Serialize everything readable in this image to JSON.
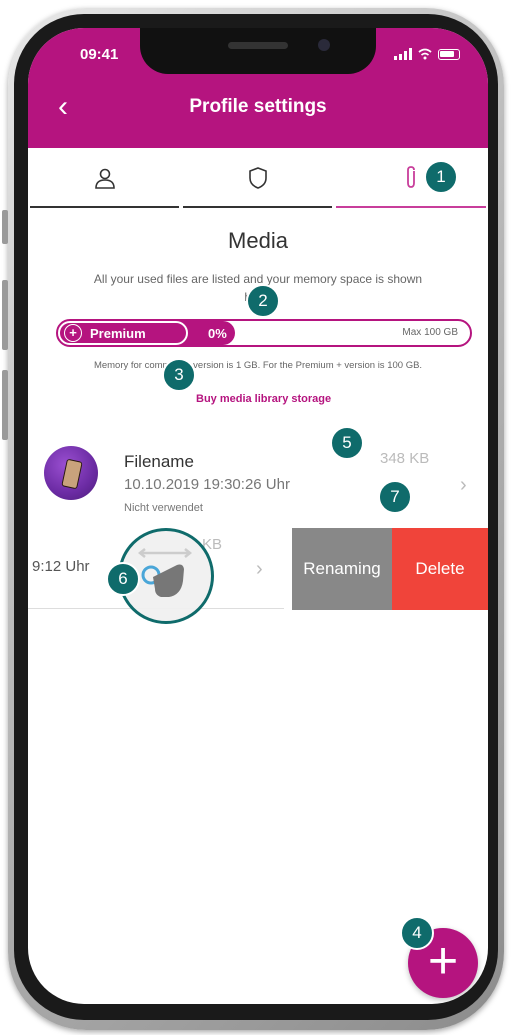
{
  "status_bar": {
    "time": "09:41"
  },
  "header": {
    "back_label": "‹",
    "title": "Profile settings"
  },
  "tabs": [
    {
      "icon": "user-icon",
      "active": false
    },
    {
      "icon": "shield-icon",
      "active": false
    },
    {
      "icon": "paperclip-icon",
      "active": true
    }
  ],
  "media": {
    "title": "Media",
    "description": "All your used files are listed and your memory space is shown here."
  },
  "storage": {
    "premium_label": "Premium",
    "percent": "0%",
    "max_label": "Max 100 GB",
    "note": "Memory for community version is 1 GB. For the Premium + version is 100 GB.",
    "buy_link": "Buy media library storage"
  },
  "file": {
    "name": "Filename",
    "date": "10.10.2019 19:30:26 Uhr",
    "status": "Nicht verwendet",
    "size": "348 KB"
  },
  "swiped_file": {
    "time_fragment": "9:12 Uhr",
    "size_fragment": "KB",
    "rename_label": "Renaming",
    "delete_label": "Delete"
  },
  "callouts": [
    "1",
    "2",
    "3",
    "4",
    "5",
    "6",
    "7"
  ],
  "fab_label": "+",
  "colors": {
    "brand": "#b5147f",
    "callout": "#0f6b6b",
    "delete": "#f0443a",
    "rename": "#888888"
  }
}
